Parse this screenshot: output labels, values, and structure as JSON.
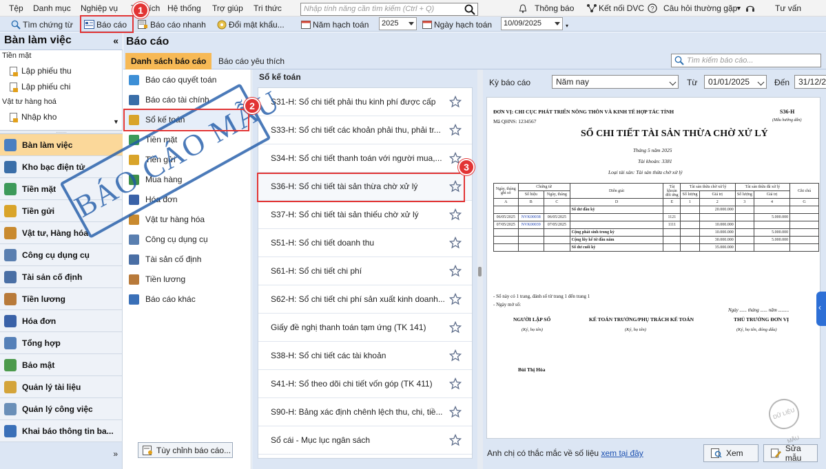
{
  "menubar": {
    "items": [
      "Tệp",
      "Danh mục",
      "Nghiệp vụ",
      "Tiện ích",
      "Hệ thống",
      "Trợ giúp",
      "Tri thức"
    ],
    "search_placeholder": "Nhập tính năng cần tìm kiếm (Ctrl + Q)",
    "notifications": "Thông báo",
    "connect": "Kết nối DVC",
    "faq": "Câu hỏi thường gặp",
    "advisor": "Tư vấn"
  },
  "toolbar": {
    "find_voucher": "Tìm chứng từ",
    "report": "Báo cáo",
    "quick_report": "Báo cáo nhanh",
    "change_password": "Đổi mật khẩu...",
    "fiscal_year_label": "Năm hạch toán",
    "fiscal_year_value": "2025",
    "posting_date_label": "Ngày hạch toán",
    "posting_date_value": "10/09/2025"
  },
  "sidebar": {
    "title": "Bàn làm việc",
    "quick": {
      "groups": [
        {
          "label": "Tiền mặt",
          "items": [
            "Lập phiếu thu",
            "Lập phiếu chi"
          ]
        },
        {
          "label": "Vật tư hàng hoá",
          "items": [
            "Nhập kho"
          ]
        }
      ]
    },
    "nav": [
      {
        "label": "Bàn làm việc",
        "icon": "desk-icon",
        "color": "#4a7fc1"
      },
      {
        "label": "Kho bạc điện tử",
        "icon": "treasury-icon",
        "color": "#3a6ea8"
      },
      {
        "label": "Tiền mặt",
        "icon": "cash-icon",
        "color": "#3d9a5a"
      },
      {
        "label": "Tiền gửi",
        "icon": "deposit-icon",
        "color": "#d9a42a"
      },
      {
        "label": "Vật tư, Hàng hóa",
        "icon": "goods-icon",
        "color": "#c98a2f"
      },
      {
        "label": "Công cụ dụng cụ",
        "icon": "tools-icon",
        "color": "#5a7fb0"
      },
      {
        "label": "Tài sản cố định",
        "icon": "asset-icon",
        "color": "#4a6fa5"
      },
      {
        "label": "Tiền lương",
        "icon": "salary-icon",
        "color": "#b87a3a"
      },
      {
        "label": "Hóa đơn",
        "icon": "invoice-icon",
        "color": "#3a62a8"
      },
      {
        "label": "Tổng hợp",
        "icon": "summary-icon",
        "color": "#5580b8"
      },
      {
        "label": "Bảo mật",
        "icon": "security-icon",
        "color": "#4c9a4c"
      },
      {
        "label": "Quản lý tài liệu",
        "icon": "documents-icon",
        "color": "#d4a43a"
      },
      {
        "label": "Quản lý công việc",
        "icon": "tasks-icon",
        "color": "#6a8fb8"
      },
      {
        "label": "Khai báo thông tin ba...",
        "icon": "declaration-icon",
        "color": "#3a70b8"
      }
    ]
  },
  "main": {
    "title": "Báo cáo",
    "tabs": [
      "Danh sách báo cáo",
      "Báo cáo yêu thích"
    ],
    "search_placeholder": "Tìm kiếm báo cáo...",
    "categories": [
      {
        "label": "Báo cáo quyết toán",
        "icon": "pie-chart-icon",
        "color": "#3d8fd6"
      },
      {
        "label": "Báo cáo tài chính",
        "icon": "finance-icon",
        "color": "#3a6ea8"
      },
      {
        "label": "Sổ kế toán",
        "icon": "ledger-icon",
        "color": "#d9a42a"
      },
      {
        "label": "Tiền mặt",
        "icon": "cash-icon",
        "color": "#3d9a5a"
      },
      {
        "label": "Tiền gửi",
        "icon": "deposit-icon",
        "color": "#d9a42a"
      },
      {
        "label": "Mua hàng",
        "icon": "purchase-icon",
        "color": "#3d8f4a"
      },
      {
        "label": "Hóa đơn",
        "icon": "invoice-icon",
        "color": "#3a62a8"
      },
      {
        "label": "Vật tư hàng hóa",
        "icon": "goods-icon",
        "color": "#c98a2f"
      },
      {
        "label": "Công cụ dụng cụ",
        "icon": "tools-icon",
        "color": "#5a7fb0"
      },
      {
        "label": "Tài sản cố định",
        "icon": "asset-icon",
        "color": "#4a6fa5"
      },
      {
        "label": "Tiền lương",
        "icon": "salary-icon",
        "color": "#b87a3a"
      },
      {
        "label": "Báo cáo khác",
        "icon": "other-report-icon",
        "color": "#3a70b8"
      }
    ],
    "customize_button": "Tùy chỉnh báo cáo..."
  },
  "reports": {
    "header": "Sổ kế toán",
    "items": [
      "S31-H: Sổ chi tiết phải thu kinh phí được cấp",
      "S33-H: Sổ chi tiết các khoản phải thu, phải tr...",
      "S34-H: Sổ chi tiết thanh toán với người mua,...",
      "S36-H: Sổ chi tiết tài sản thừa chờ xử lý",
      "S37-H: Sổ chi tiết tài sản thiếu chờ xử lý",
      "S51-H: Sổ chi tiết doanh thu",
      "S61-H: Sổ chi tiết chi phí",
      "S62-H: Sổ chi tiết chi phí sản xuất kinh doanh...",
      "Giấy đề nghị thanh toán tạm ứng (TK 141)",
      "S38-H: Sổ chi tiết các tài khoản",
      "S41-H: Sổ theo dõi chi tiết vốn góp (TK 411)",
      "S90-H: Bảng xác định chênh lệch thu, chi, tiề...",
      "Sổ cái - Mục lục ngân sách"
    ]
  },
  "preview": {
    "period_label": "Kỳ báo cáo",
    "period_value": "Năm nay",
    "from_label": "Từ",
    "from_value": "01/01/2025",
    "to_label": "Đến",
    "to_value": "31/12/2",
    "paper": {
      "unit": "ĐƠN VỊ: CHI CỤC PHÁT TRIỂN NÔNG THÔN VÀ KINH TẾ HỢP TÁC TỈNH",
      "code": "Mã QHNS: 1234567",
      "form_no": "S36-H",
      "form_note": "(Mẫu hướng dẫn)",
      "title": "SỔ CHI TIẾT TÀI SẢN THỪA CHỜ XỬ LÝ",
      "month": "Tháng 5 năm 2025",
      "account": "Tài khoản: 3381",
      "asset_type": "Loại tài sản: Tài sản thừa chờ xử lý",
      "headers": {
        "date": "Ngày, tháng ghi sổ",
        "voucher": "Chứng từ",
        "voucher_no": "Số hiệu",
        "voucher_date": "Ngày, tháng",
        "desc": "Diễn giải",
        "contra": "Tài khoản đối ứng",
        "pending": "Tài sản thừa chờ xử lý",
        "processed": "Tài sản thừa đã xử lý",
        "qty": "Số lượng",
        "value": "Giá trị",
        "note": "Ghi chú"
      },
      "col_codes": [
        "A",
        "B",
        "C",
        "D",
        "E",
        "1",
        "2",
        "3",
        "4",
        "G"
      ],
      "rows": [
        {
          "d": "",
          "no": "",
          "vd": "",
          "desc": "Số dư đầu kỳ",
          "acc": "",
          "q1": "",
          "v1": "20.000.000",
          "q2": "",
          "v2": ""
        },
        {
          "d": "06/05/2025",
          "no": "NVK00038",
          "vd": "06/05/2025",
          "desc": "",
          "acc": "1121",
          "q1": "",
          "v1": "",
          "q2": "",
          "v2": "5.000.000"
        },
        {
          "d": "07/05/2025",
          "no": "NVK00039",
          "vd": "07/05/2025",
          "desc": "",
          "acc": "1111",
          "q1": "",
          "v1": "10.000.000",
          "q2": "",
          "v2": ""
        },
        {
          "d": "",
          "no": "",
          "vd": "",
          "desc": "Cộng phát sinh trong kỳ",
          "acc": "",
          "q1": "",
          "v1": "10.000.000",
          "q2": "",
          "v2": "5.000.000"
        },
        {
          "d": "",
          "no": "",
          "vd": "",
          "desc": "Cộng lũy kế từ đầu năm",
          "acc": "",
          "q1": "",
          "v1": "30.000.000",
          "q2": "",
          "v2": "5.000.000"
        },
        {
          "d": "",
          "no": "",
          "vd": "",
          "desc": "Số dư cuối kỳ",
          "acc": "",
          "q1": "",
          "v1": "35.000.000",
          "q2": "",
          "v2": ""
        }
      ],
      "pages": "- Sổ này có 1 trang, đánh số từ trang 1 đến trang 1",
      "open_date": "- Ngày mở sổ:",
      "sign_date": "Ngày ...... tháng ...... năm .........",
      "sign1": "NGƯỜI LẬP SỔ",
      "sign2": "KẾ TOÁN TRƯỞNG/PHỤ TRÁCH KẾ TOÁN",
      "sign3": "THỦ TRƯỞNG ĐƠN VỊ",
      "sign_note": "(Ký, họ tên)",
      "sign_note3": "(Ký, họ tên, đóng dấu)",
      "signer": "Bùi Thị Hòa",
      "stamp": "BÁO CÁO MẪU",
      "small_stamp": "DỮ LIỆU MẪU"
    },
    "question": "Anh chị có thắc mắc về số liệu",
    "question_link": "xem tại đây",
    "view_button": "Xem",
    "edit_button": "Sửa mẫu"
  },
  "callouts": [
    "1",
    "2",
    "3"
  ],
  "colors": {
    "accent": "#f7b955",
    "callout": "#e23434",
    "toolbar": "#dce6f4"
  }
}
